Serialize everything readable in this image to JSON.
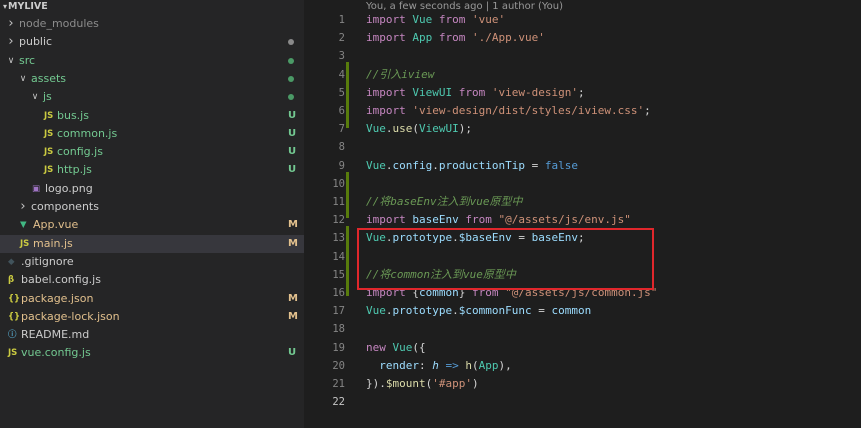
{
  "explorer": {
    "root": "MYLIVE",
    "items": [
      {
        "label": "node_modules",
        "kind": "folder",
        "expanded": false,
        "depth": 0,
        "status": "",
        "color": "#8c8c8c"
      },
      {
        "label": "public",
        "kind": "folder",
        "expanded": false,
        "depth": 0,
        "status": "dot",
        "color": "#cccccc"
      },
      {
        "label": "src",
        "kind": "folder",
        "expanded": true,
        "depth": 0,
        "status": "dot-green",
        "color": "#73c991"
      },
      {
        "label": "assets",
        "kind": "folder",
        "expanded": true,
        "depth": 1,
        "status": "dot-green",
        "color": "#73c991"
      },
      {
        "label": "js",
        "kind": "folder",
        "expanded": true,
        "depth": 2,
        "status": "dot-green",
        "color": "#73c991"
      },
      {
        "label": "bus.js",
        "kind": "js",
        "depth": 3,
        "status": "U",
        "color": "#73c991"
      },
      {
        "label": "common.js",
        "kind": "js",
        "depth": 3,
        "status": "U",
        "color": "#73c991"
      },
      {
        "label": "config.js",
        "kind": "js",
        "depth": 3,
        "status": "U",
        "color": "#73c991"
      },
      {
        "label": "http.js",
        "kind": "js",
        "depth": 3,
        "status": "U",
        "color": "#73c991"
      },
      {
        "label": "logo.png",
        "kind": "image",
        "depth": 2,
        "status": "",
        "color": "#cccccc"
      },
      {
        "label": "components",
        "kind": "folder",
        "expanded": false,
        "depth": 1,
        "status": "",
        "color": "#cccccc"
      },
      {
        "label": "App.vue",
        "kind": "vue",
        "depth": 1,
        "status": "M",
        "color": "#e2c08d"
      },
      {
        "label": "main.js",
        "kind": "js",
        "depth": 1,
        "status": "M",
        "color": "#e2c08d",
        "selected": true
      },
      {
        "label": ".gitignore",
        "kind": "git",
        "depth": 0,
        "status": "",
        "color": "#cccccc"
      },
      {
        "label": "babel.config.js",
        "kind": "babel",
        "depth": 0,
        "status": "",
        "color": "#cccccc"
      },
      {
        "label": "package.json",
        "kind": "json",
        "depth": 0,
        "status": "M",
        "color": "#e2c08d"
      },
      {
        "label": "package-lock.json",
        "kind": "json",
        "depth": 0,
        "status": "M",
        "color": "#e2c08d"
      },
      {
        "label": "README.md",
        "kind": "info",
        "depth": 0,
        "status": "",
        "color": "#cccccc"
      },
      {
        "label": "vue.config.js",
        "kind": "js",
        "depth": 0,
        "status": "U",
        "color": "#73c991"
      }
    ]
  },
  "editor": {
    "blame": "You, a few seconds ago | 1 author (You)",
    "active_line": 22,
    "lines": [
      {
        "n": "1",
        "tokens": [
          [
            "kw",
            "import "
          ],
          [
            "cls",
            "Vue"
          ],
          [
            "kw",
            " from "
          ],
          [
            "str",
            "'vue'"
          ]
        ]
      },
      {
        "n": "2",
        "tokens": [
          [
            "kw",
            "import "
          ],
          [
            "cls",
            "App"
          ],
          [
            "kw",
            " from "
          ],
          [
            "str",
            "'./App.vue'"
          ]
        ]
      },
      {
        "n": "3",
        "tokens": []
      },
      {
        "n": "4",
        "tokens": [
          [
            "cmt",
            "//引入iview"
          ]
        ]
      },
      {
        "n": "5",
        "tokens": [
          [
            "kw",
            "import "
          ],
          [
            "cls",
            "ViewUI"
          ],
          [
            "kw",
            " from "
          ],
          [
            "str",
            "'view-design'"
          ],
          [
            "plain",
            ";"
          ]
        ]
      },
      {
        "n": "6",
        "tokens": [
          [
            "kw",
            "import "
          ],
          [
            "str",
            "'view-design/dist/styles/iview.css'"
          ],
          [
            "plain",
            ";"
          ]
        ]
      },
      {
        "n": "7",
        "tokens": [
          [
            "cls",
            "Vue"
          ],
          [
            "plain",
            "."
          ],
          [
            "fn",
            "use"
          ],
          [
            "plain",
            "("
          ],
          [
            "cls",
            "ViewUI"
          ],
          [
            "plain",
            ");"
          ]
        ]
      },
      {
        "n": "8",
        "tokens": []
      },
      {
        "n": "9",
        "tokens": [
          [
            "cls",
            "Vue"
          ],
          [
            "plain",
            "."
          ],
          [
            "prop",
            "config"
          ],
          [
            "plain",
            "."
          ],
          [
            "prop",
            "productionTip"
          ],
          [
            "plain",
            " = "
          ],
          [
            "bool",
            "false"
          ]
        ]
      },
      {
        "n": "10",
        "tokens": []
      },
      {
        "n": "11",
        "tokens": [
          [
            "cmt",
            "//将baseEnv注入到vue原型中"
          ]
        ]
      },
      {
        "n": "12",
        "tokens": [
          [
            "kw",
            "import "
          ],
          [
            "id",
            "baseEnv"
          ],
          [
            "kw",
            " from "
          ],
          [
            "str",
            "\"@/assets/js/env.js\""
          ]
        ]
      },
      {
        "n": "13",
        "tokens": [
          [
            "cls",
            "Vue"
          ],
          [
            "plain",
            "."
          ],
          [
            "prop",
            "prototype"
          ],
          [
            "plain",
            "."
          ],
          [
            "prop",
            "$baseEnv"
          ],
          [
            "plain",
            " = "
          ],
          [
            "id",
            "baseEnv"
          ],
          [
            "plain",
            ";"
          ]
        ]
      },
      {
        "n": "14",
        "tokens": []
      },
      {
        "n": "15",
        "tokens": [
          [
            "cmt",
            "//将common注入到vue原型中"
          ]
        ]
      },
      {
        "n": "16",
        "tokens": [
          [
            "kw",
            "import "
          ],
          [
            "plain",
            "{"
          ],
          [
            "id",
            "common"
          ],
          [
            "plain",
            "} "
          ],
          [
            "kw",
            "from "
          ],
          [
            "str",
            "\"@/assets/js/common.js\""
          ]
        ]
      },
      {
        "n": "17",
        "tokens": [
          [
            "cls",
            "Vue"
          ],
          [
            "plain",
            "."
          ],
          [
            "prop",
            "prototype"
          ],
          [
            "plain",
            "."
          ],
          [
            "prop",
            "$commonFunc"
          ],
          [
            "plain",
            " = "
          ],
          [
            "id",
            "common"
          ]
        ]
      },
      {
        "n": "18",
        "tokens": []
      },
      {
        "n": "19",
        "tokens": [
          [
            "kw",
            "new "
          ],
          [
            "cls",
            "Vue"
          ],
          [
            "plain",
            "({"
          ]
        ]
      },
      {
        "n": "20",
        "tokens": [
          [
            "plain",
            "  "
          ],
          [
            "prop",
            "render"
          ],
          [
            "plain",
            ": "
          ],
          [
            "param",
            "h"
          ],
          [
            "plain",
            " "
          ],
          [
            "bool",
            "=>"
          ],
          [
            "plain",
            " "
          ],
          [
            "fn",
            "h"
          ],
          [
            "plain",
            "("
          ],
          [
            "cls",
            "App"
          ],
          [
            "plain",
            "),"
          ]
        ]
      },
      {
        "n": "21",
        "tokens": [
          [
            "plain",
            "})."
          ],
          [
            "fn",
            "$mount"
          ],
          [
            "plain",
            "("
          ],
          [
            "str",
            "'#app'"
          ],
          [
            "plain",
            ")"
          ]
        ]
      },
      {
        "n": "22",
        "tokens": []
      }
    ]
  }
}
